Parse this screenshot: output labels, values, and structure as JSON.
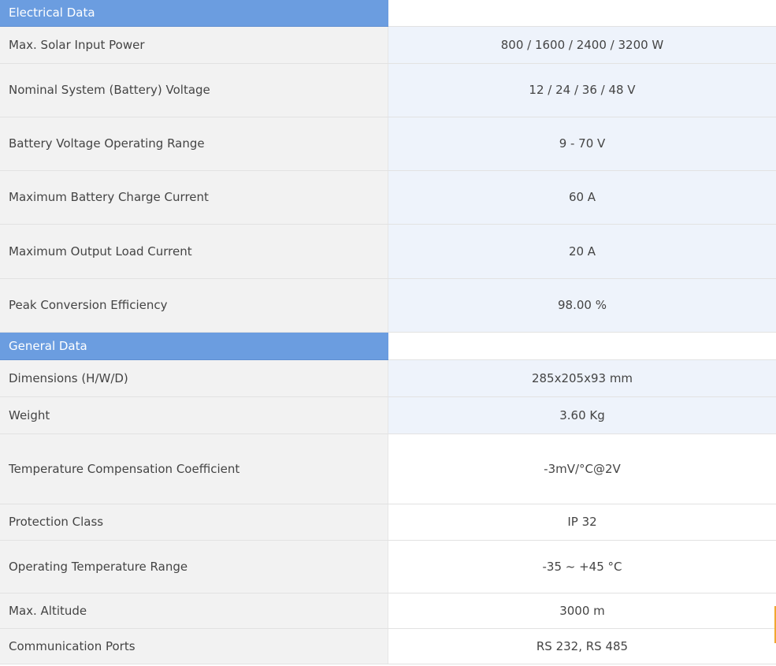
{
  "sections": [
    {
      "title": "Electrical Data",
      "rows": [
        {
          "label": "Max. Solar Input Power",
          "value": "800 / 1600 / 2400 / 3200 W"
        },
        {
          "label": "Nominal System (Battery) Voltage",
          "value": "12 / 24 / 36 / 48 V"
        },
        {
          "label": "Battery Voltage Operating Range",
          "value": "9 - 70 V"
        },
        {
          "label": "Maximum Battery Charge Current",
          "value": "60 A"
        },
        {
          "label": "Maximum Output Load Current",
          "value": "20 A"
        },
        {
          "label": "Peak Conversion Efficiency",
          "value": "98.00 %"
        }
      ]
    },
    {
      "title": "General Data",
      "rows": [
        {
          "label": "Dimensions (H/W/D)",
          "value": "285x205x93 mm"
        },
        {
          "label": "Weight",
          "value": "3.60 Kg"
        },
        {
          "label": "Temperature Compensation Coefficient",
          "value": "-3mV/°C@2V"
        },
        {
          "label": "Protection Class",
          "value": "IP 32"
        },
        {
          "label": "Operating Temperature Range",
          "value": "-35 ~ +45 °C"
        },
        {
          "label": "Max. Altitude",
          "value": "3000 m"
        },
        {
          "label": "Communication Ports",
          "value": "RS 232, RS 485"
        }
      ]
    }
  ],
  "colors": {
    "section_header": "#6b9de0",
    "label_bg": "#f2f2f2",
    "tinted_value_bg": "#eef3fb",
    "accent_tab": "#f0a830"
  }
}
